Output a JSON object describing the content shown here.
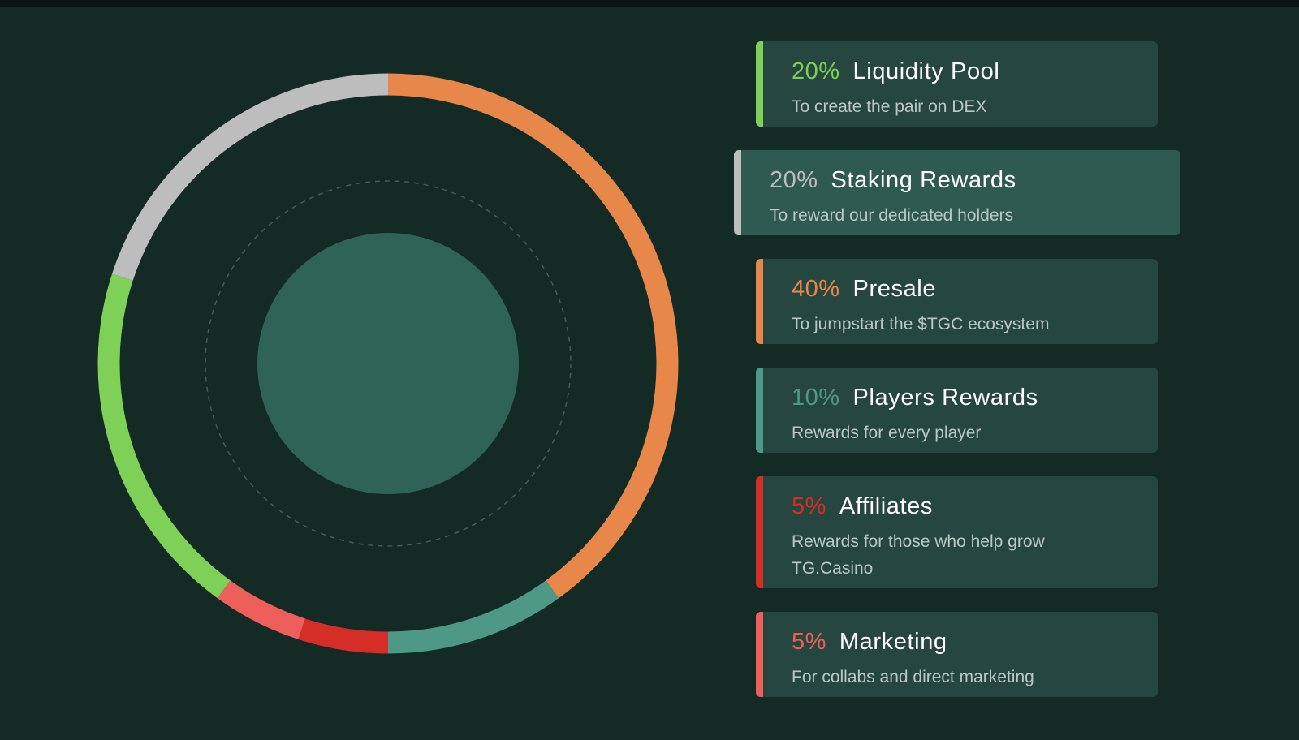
{
  "chart_data": {
    "type": "pie",
    "variant": "donut",
    "categories": [
      "Liquidity Pool",
      "Staking Rewards",
      "Presale",
      "Players Rewards",
      "Affiliates",
      "Marketing"
    ],
    "values": [
      20,
      20,
      40,
      10,
      5,
      5
    ],
    "colors": [
      "#7ed156",
      "#bdbdbd",
      "#e8874a",
      "#4d9985",
      "#d42e26",
      "#ee5e5a"
    ],
    "start_slice": "Presale",
    "direction": "clockwise",
    "title": "",
    "legend_position": "right"
  },
  "legend": {
    "items": [
      {
        "percent": "20%",
        "name": "Liquidity Pool",
        "description": "To create the pair on DEX",
        "color": "#7ed156",
        "active": false
      },
      {
        "percent": "20%",
        "name": "Staking Rewards",
        "description": "To reward our dedicated holders",
        "color": "#bdbdbd",
        "active": true
      },
      {
        "percent": "40%",
        "name": "Presale",
        "description": "To jumpstart the $TGC ecosystem",
        "color": "#e8874a",
        "active": false
      },
      {
        "percent": "10%",
        "name": "Players Rewards",
        "description": "Rewards for every player",
        "color": "#4d9985",
        "active": false
      },
      {
        "percent": "5%",
        "name": "Affiliates",
        "description": "Rewards for those who help grow TG.Casino",
        "color": "#d42e26",
        "active": false
      },
      {
        "percent": "5%",
        "name": "Marketing",
        "description": "For collabs and direct marketing",
        "color": "#ee5e5a",
        "active": false
      }
    ]
  },
  "colors": {
    "background": "#132a25",
    "card": "#264640",
    "card_active": "#2e5a50",
    "center_disc": "#2f6356"
  }
}
